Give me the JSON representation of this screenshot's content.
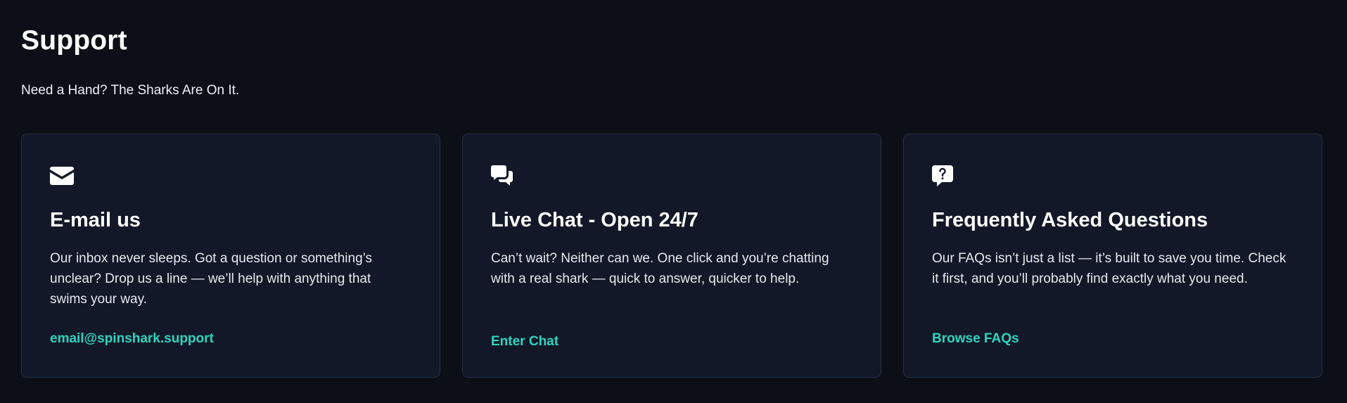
{
  "header": {
    "title": "Support",
    "subtitle": "Need a Hand? The Sharks Are On It."
  },
  "cards": [
    {
      "icon": "envelope-icon",
      "title": "E-mail us",
      "text": "Our inbox never sleeps. Got a question or something’s unclear? Drop us a line — we’ll help with anything that swims your way.",
      "link": "email@spinshark.support"
    },
    {
      "icon": "chat-bubbles-icon",
      "title": "Live Chat - Open 24/7",
      "text": "Can’t wait? Neither can we. One click and you’re chatting with a real shark — quick to answer, quicker to help.",
      "link": "Enter Chat"
    },
    {
      "icon": "question-bubble-icon",
      "title": "Frequently Asked Questions",
      "text": "Our FAQs isn’t just a list — it’s built to save you time. Check it first, and you’ll probably find exactly what you need.",
      "link": "Browse FAQs"
    }
  ],
  "colors": {
    "background": "#0c0f17",
    "card_background": "#121827",
    "card_border": "#272f40",
    "accent": "#2dd4bf",
    "text": "#ffffff"
  }
}
